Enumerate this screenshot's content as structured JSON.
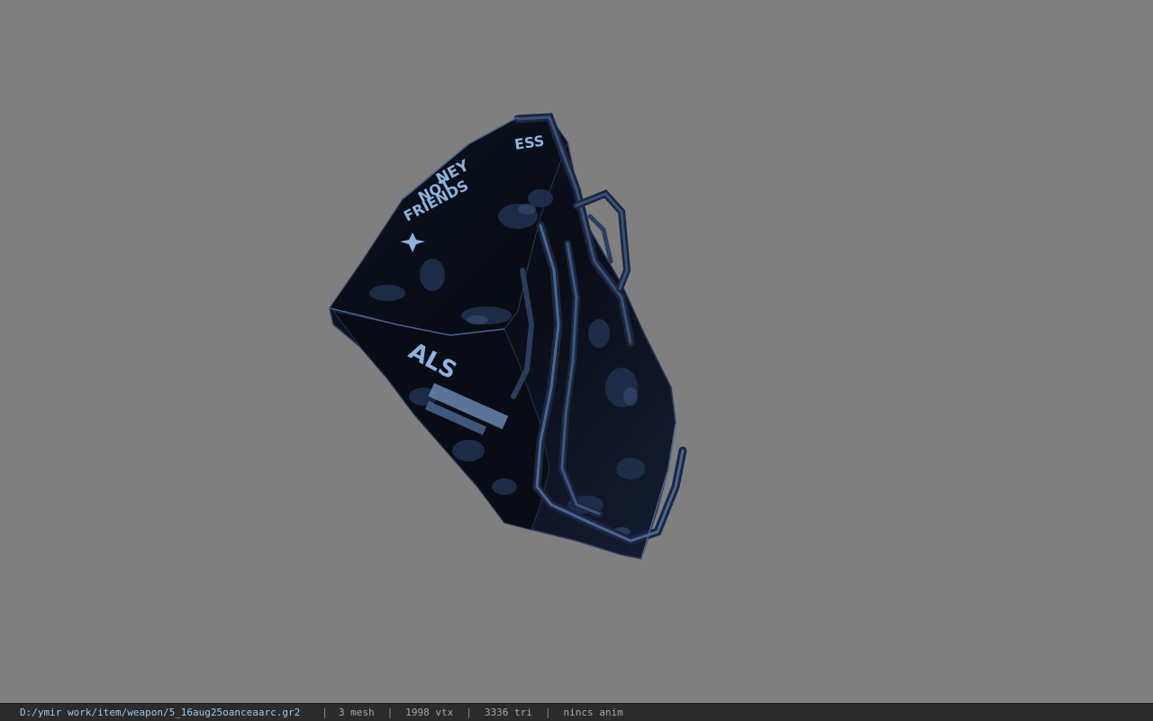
{
  "viewport": {
    "background_color": "#7f7f7f",
    "model": {
      "description_icon": "bag-model",
      "colors": {
        "body": "#0a0d16",
        "highlight": "#3a5076",
        "print": "#8fb2dc"
      },
      "print_text": {
        "line1": "ESS",
        "line2": "NEY",
        "line3": "NOT",
        "line4": "FRIENDS",
        "line5": "ALS"
      }
    }
  },
  "status_bar": {
    "file_path": "D:/ymir work/item/weapon/5_16aug25oanceaarc.gr2",
    "mesh_count": "3 mesh",
    "vertex_count": "1998 vtx",
    "triangle_count": "3336 tri",
    "anim": "nincs anim",
    "separator": "|"
  }
}
